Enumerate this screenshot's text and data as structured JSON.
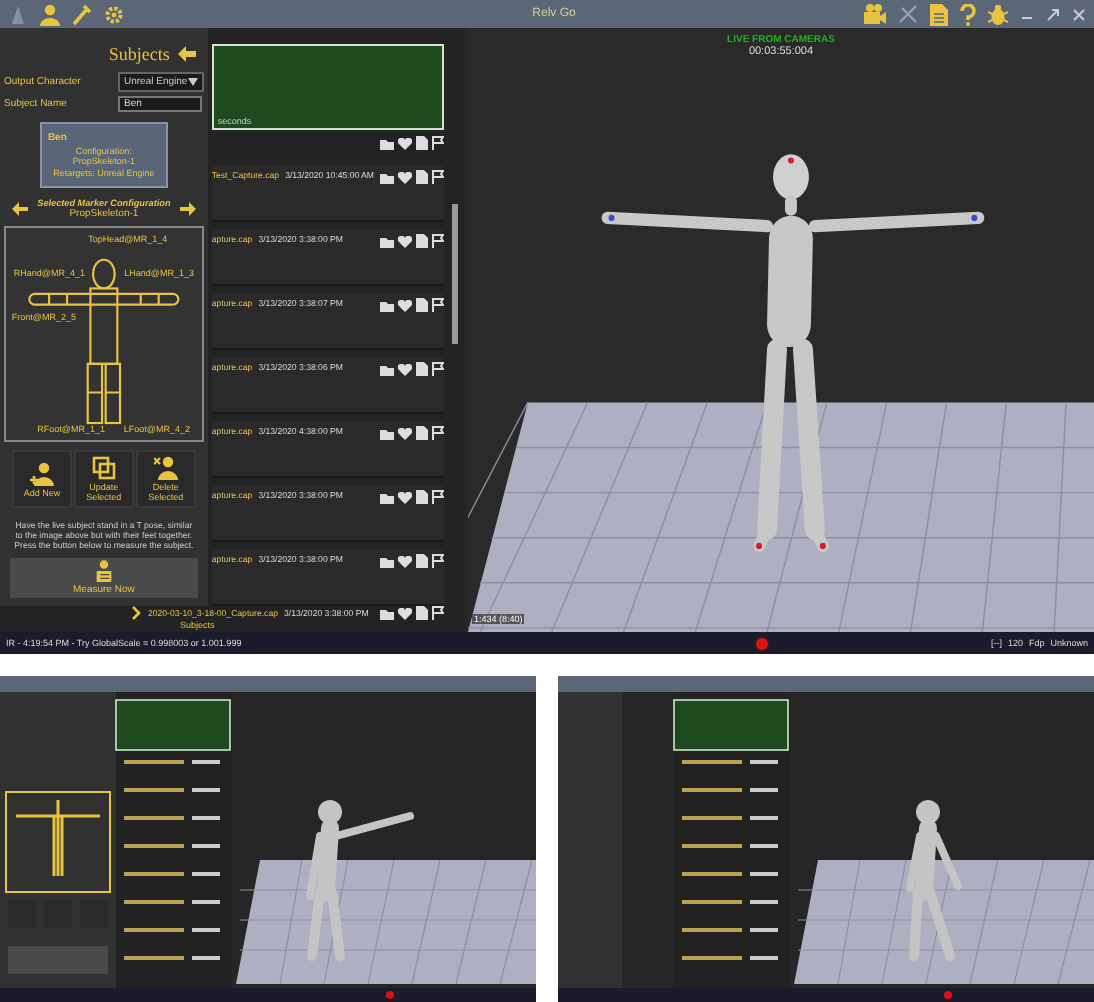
{
  "main_screen": {
    "window": {
      "title": "Relv Go"
    },
    "subjects_panel": {
      "title": "Subjects",
      "fields": [
        {
          "label": "Output Character",
          "kind": "dropdown",
          "value": "Unreal Engine"
        },
        {
          "label": "Subject Name",
          "kind": "input",
          "value": "Ben"
        }
      ],
      "subject_card": {
        "name": "Ben",
        "configuration": "Configuration: PropSkeleton-1",
        "retargets": "Retargets: Unreal Engine"
      },
      "marker_config": {
        "heading": "Selected Marker Configuration",
        "name": "PropSkeleton-1",
        "markers": [
          "TopHead@MR_1_4",
          "RHand@MR_4_1",
          "LHand@MR_1_3",
          "Front@MR_2_5",
          "RFoot@MR_1_1",
          "LFoot@MR_4_2"
        ]
      },
      "actions": [
        {
          "label": "Add New",
          "kind": "add"
        },
        {
          "label": "Update Selected",
          "kind": "update"
        },
        {
          "label": "Delete Selected",
          "kind": "delete"
        }
      ],
      "instructions": "Have the live subject stand in a T pose, similar to the image above but with their feet together. Press the button below to measure the subject.",
      "measure_button": "Measure Now"
    },
    "captures": {
      "note": "seconds",
      "rows": [
        {
          "name": "Test_Capture.cap",
          "time": "3/13/2020 10:45:00 AM"
        },
        {
          "name": "apture.cap",
          "time": "3/13/2020 3:38:00 PM"
        },
        {
          "name": "apture.cap",
          "time": "3/13/2020 3:38:07 PM"
        },
        {
          "name": "apture.cap",
          "time": "3/13/2020 3:38:06 PM"
        },
        {
          "name": "apture.cap",
          "time": "3/13/2020 4:38:00 PM"
        },
        {
          "name": "apture.cap",
          "time": "3/13/2020 3:38:00 PM"
        },
        {
          "name": "apture.cap",
          "time": "3/13/2020 3:38:00 PM"
        }
      ],
      "last_row": {
        "name": "2020-03-10_3-18-00_Capture.cap",
        "time": "3/13/2020 3:38:00 PM",
        "sub_label": "Subjects"
      }
    },
    "viewport": {
      "status": "LIVE FROM CAMERAS",
      "timecode": "00:03:55:004",
      "frame_label": "1:434 (8:40)"
    },
    "status_bar": {
      "message": "IR - 4:19:54 PM - Try GlobalScale = 0.998003 or 1.001.999",
      "recording": true,
      "fields": [
        "[--]",
        "120",
        "Fdp",
        "Unknown"
      ]
    }
  }
}
